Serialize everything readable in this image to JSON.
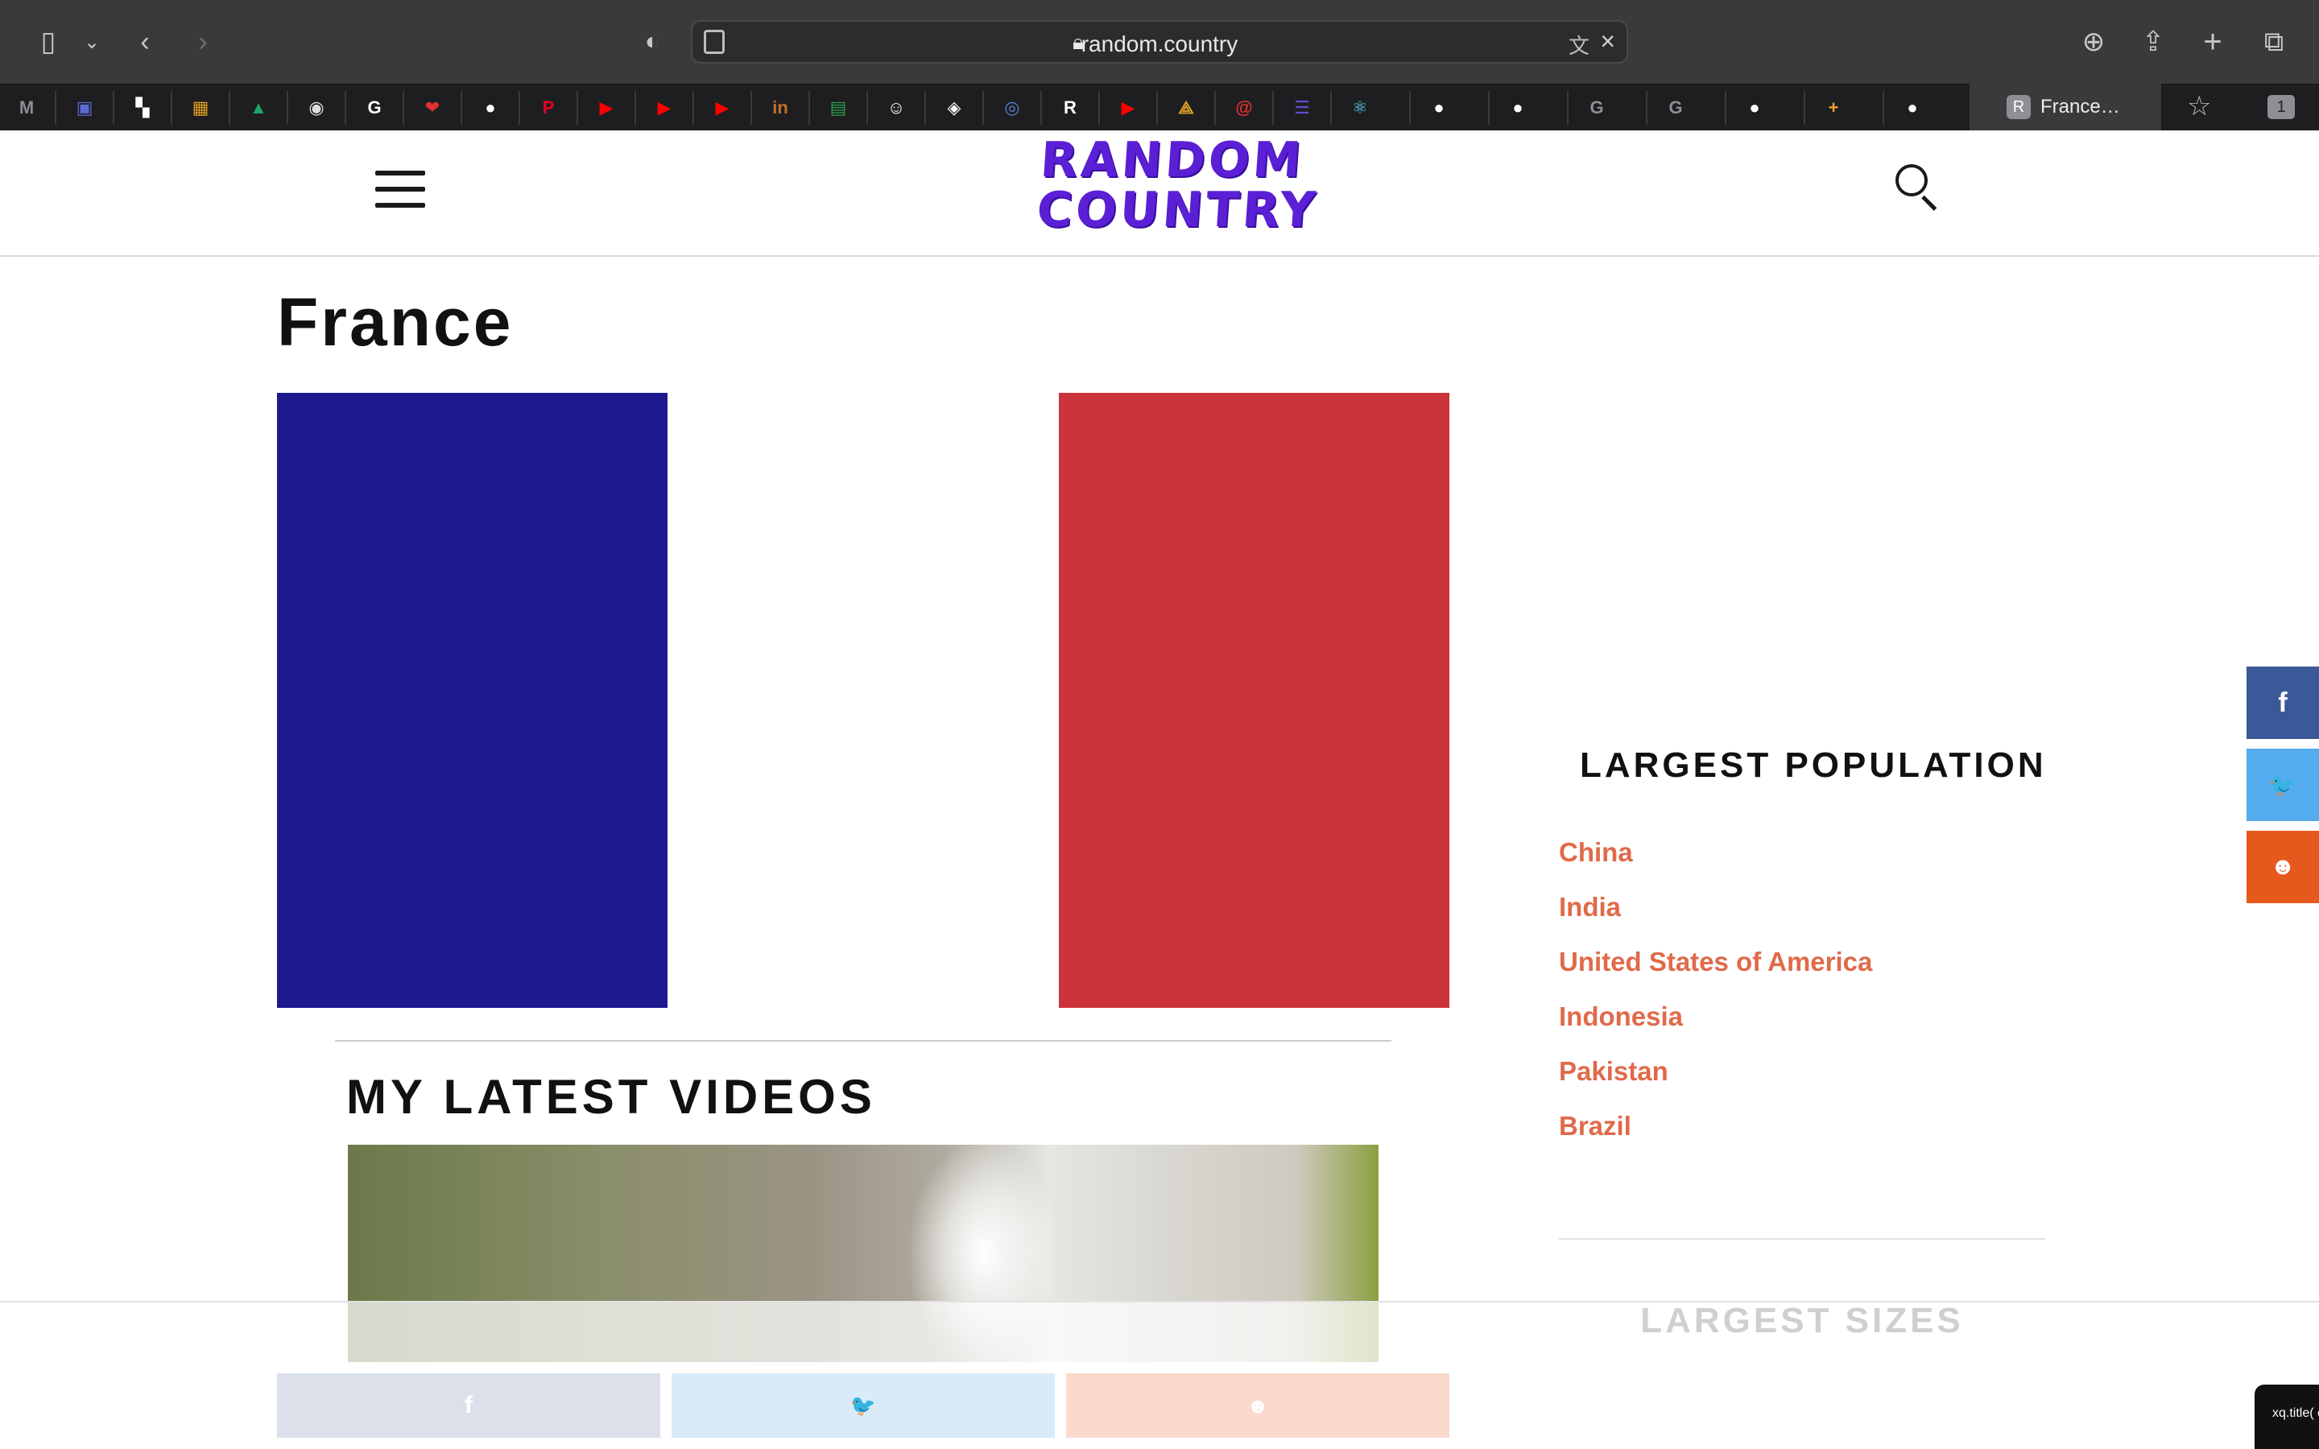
{
  "browser": {
    "url": "random.country",
    "active_tab": {
      "label": "France…",
      "icon_letter": "R"
    },
    "tab_count": "1",
    "favicons": [
      {
        "name": "gmail-m",
        "glyph": "M",
        "color": "#8e8e93"
      },
      {
        "name": "app-window",
        "glyph": "▣",
        "color": "#5b6ad6"
      },
      {
        "name": "checker",
        "glyph": "▚",
        "color": "#ffffff"
      },
      {
        "name": "colors",
        "glyph": "▦",
        "color": "#e0a020"
      },
      {
        "name": "google-drive",
        "glyph": "▲",
        "color": "#1ea362"
      },
      {
        "name": "eye",
        "glyph": "◉",
        "color": "#dddddd"
      },
      {
        "name": "google",
        "glyph": "G",
        "color": "#ffffff"
      },
      {
        "name": "heart",
        "glyph": "❤",
        "color": "#e03030"
      },
      {
        "name": "github",
        "glyph": "●",
        "color": "#ffffff"
      },
      {
        "name": "pinterest",
        "glyph": "P",
        "color": "#e60023"
      },
      {
        "name": "youtube",
        "glyph": "▶",
        "color": "#ff0000"
      },
      {
        "name": "youtube",
        "glyph": "▶",
        "color": "#ff0000"
      },
      {
        "name": "youtube",
        "glyph": "▶",
        "color": "#ff0000"
      },
      {
        "name": "in",
        "glyph": "in",
        "color": "#c0702a"
      },
      {
        "name": "classroom",
        "glyph": "▤",
        "color": "#2a9d4a"
      },
      {
        "name": "panda",
        "glyph": "☺",
        "color": "#ffffff"
      },
      {
        "name": "codepen",
        "glyph": "◈",
        "color": "#ffffff"
      },
      {
        "name": "circle",
        "glyph": "◎",
        "color": "#5b7fd6"
      },
      {
        "name": "r-script",
        "glyph": "R",
        "color": "#ffffff"
      },
      {
        "name": "youtube",
        "glyph": "▶",
        "color": "#ff0000"
      },
      {
        "name": "triangle",
        "glyph": "⟁",
        "color": "#e0a020"
      },
      {
        "name": "swirl",
        "glyph": "@",
        "color": "#e03030"
      },
      {
        "name": "list",
        "glyph": "☰",
        "color": "#6a4ad6"
      },
      {
        "name": "react",
        "glyph": "⚛",
        "color": "#61dafb"
      },
      {
        "name": "github",
        "glyph": "●",
        "color": "#ffffff"
      },
      {
        "name": "github",
        "glyph": "●",
        "color": "#ffffff"
      },
      {
        "name": "g-grey",
        "glyph": "G",
        "color": "#8e8e93"
      },
      {
        "name": "g-grey",
        "glyph": "G",
        "color": "#8e8e93"
      },
      {
        "name": "github",
        "glyph": "●",
        "color": "#ffffff"
      },
      {
        "name": "plus-orange",
        "glyph": "+",
        "color": "#f0a030"
      },
      {
        "name": "github",
        "glyph": "●",
        "color": "#ffffff"
      }
    ]
  },
  "header": {
    "logo_line1": "RANDOM",
    "logo_line2": "COUNTRY",
    "logo_color": "#5b1fd6"
  },
  "country": {
    "name": "France",
    "flag_colors": [
      "#1d1a8f",
      "#ffffff",
      "#cc333b"
    ]
  },
  "videos": {
    "heading": "MY LATEST VIDEOS"
  },
  "sidebar": {
    "population_heading": "LARGEST POPULATION",
    "population_list": [
      "China",
      "India",
      "United States of America",
      "Indonesia",
      "Pakistan",
      "Brazil"
    ],
    "sizes_heading": "LARGEST SIZES",
    "link_color": "#e06a4a"
  },
  "share": {
    "facebook": {
      "glyph": "f",
      "color": "#3b5998"
    },
    "twitter": {
      "glyph": "🐦",
      "color": "#55acee"
    },
    "reddit": {
      "glyph": "☻",
      "color": "#e55a1c"
    }
  },
  "tooltip_text": "xq.title( colo padd"
}
